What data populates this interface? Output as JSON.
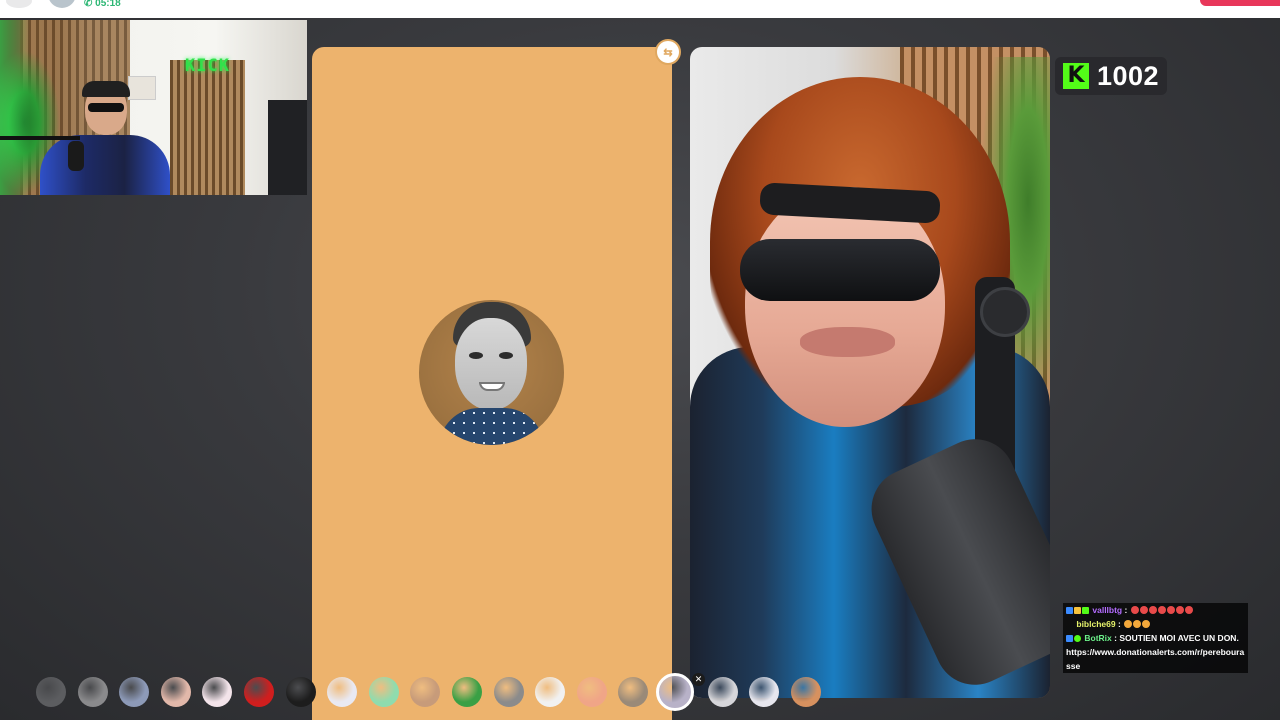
{
  "top_bar": {
    "call_time": "05:18"
  },
  "webcam": {
    "sign_text": "KICK"
  },
  "video_panels": {
    "swap_icon": "swap-icon"
  },
  "kick_counter": {
    "icon": "kick-logo-icon",
    "count": "1002",
    "brand_color": "#53fc18"
  },
  "chat": {
    "messages": [
      {
        "user": "valllbtg",
        "separator": " :",
        "text": ""
      },
      {
        "user": "biblche69",
        "separator": " :",
        "text": ""
      },
      {
        "user": "BotRix",
        "separator": " :",
        "text": " SOUTIEN MOI AVEC UN DON. https://www.donationalerts.com/r/pereboura sse"
      }
    ]
  },
  "filters": {
    "items": [
      {
        "name": "filter-dim",
        "color": "#5c5d60"
      },
      {
        "name": "filter-mask",
        "color": "#8a8a8c"
      },
      {
        "name": "filter-blur",
        "color": "#8d9ab8"
      },
      {
        "name": "filter-skin",
        "color": "#e2b8aa"
      },
      {
        "name": "filter-cute",
        "color": "#f3e4ea"
      },
      {
        "name": "filter-devil",
        "color": "#d01e1e"
      },
      {
        "name": "filter-speed",
        "color": "#1d1d1d"
      },
      {
        "name": "filter-stars",
        "color": "#e9e9f2"
      },
      {
        "name": "filter-zombie",
        "color": "#8fdcae"
      },
      {
        "name": "filter-beard",
        "color": "#c79b7a"
      },
      {
        "name": "filter-alien",
        "color": "#3aa045"
      },
      {
        "name": "filter-sunglasses",
        "color": "#8b8b8b"
      },
      {
        "name": "filter-ghost",
        "color": "#f1f1f1"
      },
      {
        "name": "filter-peach",
        "color": "#f0a587"
      },
      {
        "name": "filter-donkey",
        "color": "#9a8a78"
      },
      {
        "name": "filter-selected-hair",
        "color": "#b8b2c8"
      },
      {
        "name": "filter-sad",
        "color": "#d6d6da"
      },
      {
        "name": "filter-blank",
        "color": "#e6e6ee"
      },
      {
        "name": "filter-bald",
        "color": "#d7915f"
      }
    ],
    "selected_index": 15
  }
}
